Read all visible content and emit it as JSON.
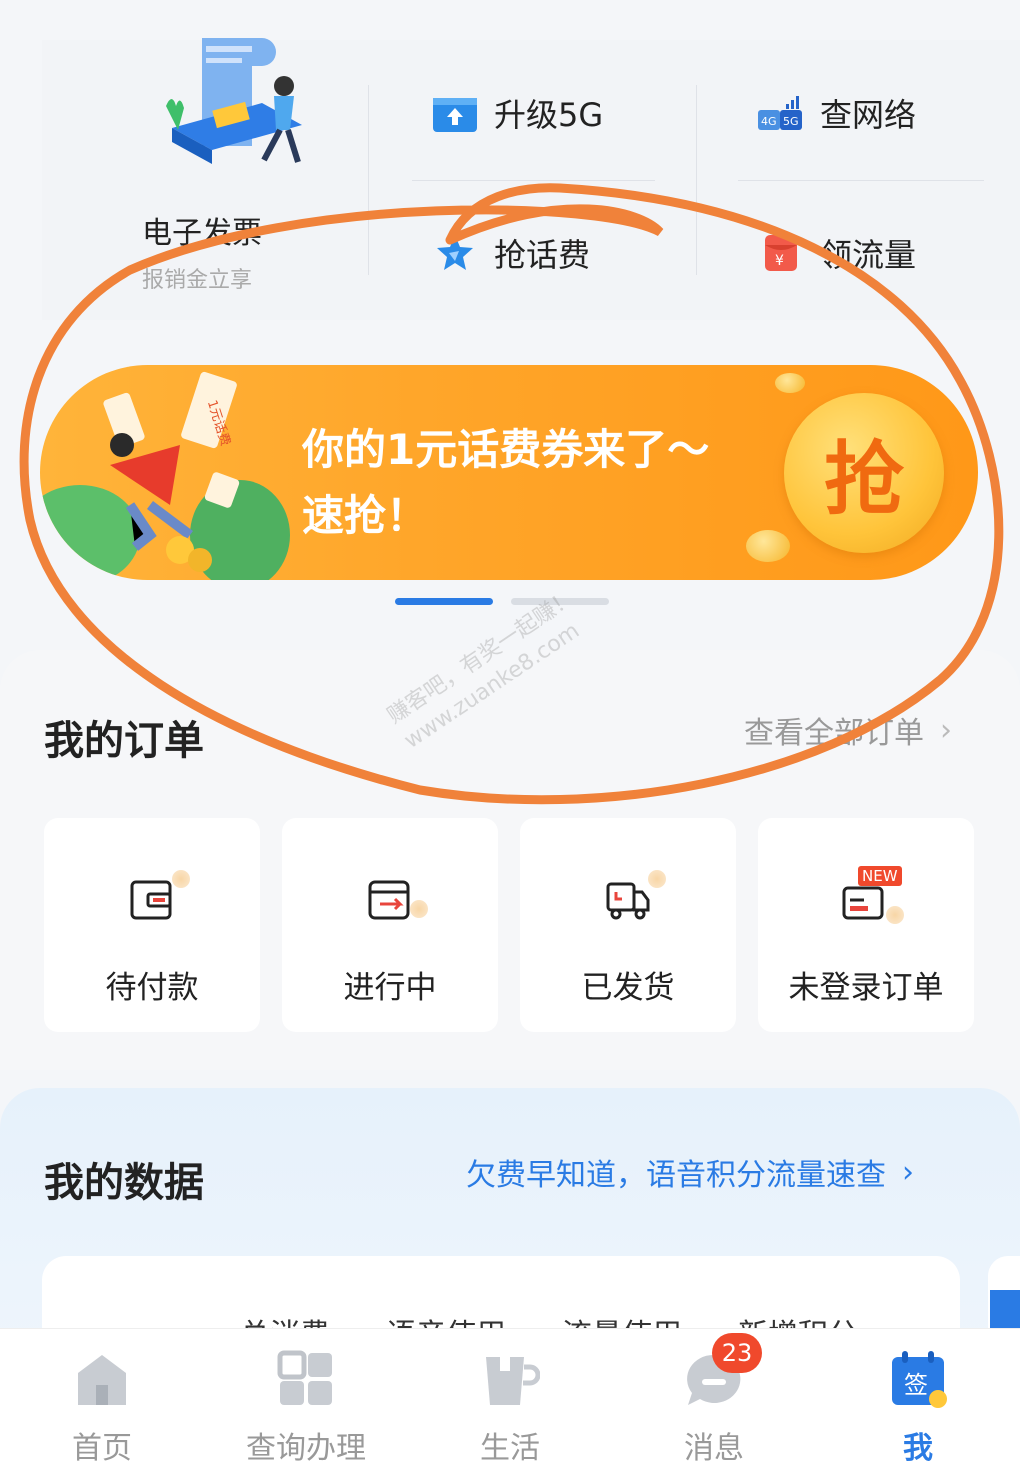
{
  "top": {
    "invoice_title": "电子发票",
    "invoice_sub": "报销金立享",
    "services": [
      {
        "label": "升级5G",
        "icon": "upload-icon"
      },
      {
        "label": "查网络",
        "icon": "4g5g-signal-icon"
      },
      {
        "label": "抢话费",
        "icon": "star-icon"
      },
      {
        "label": "领流量",
        "icon": "red-packet-icon"
      }
    ]
  },
  "banner": {
    "line1": "你的1元话费券来了～",
    "line2": "速抢！",
    "button": "抢",
    "ticket_text": "1元话费"
  },
  "orders": {
    "title": "我的订单",
    "link": "查看全部订单",
    "items": [
      {
        "label": "待付款",
        "icon": "wallet-icon"
      },
      {
        "label": "进行中",
        "icon": "in-progress-icon"
      },
      {
        "label": "已发货",
        "icon": "truck-icon"
      },
      {
        "label": "未登录订单",
        "icon": "card-icon",
        "badge": "NEW"
      }
    ]
  },
  "data": {
    "title": "我的数据",
    "link": "欠费早知道，语音积分流量速查",
    "labels": [
      "总消费",
      "语音使用",
      "流量使用",
      "新增积分"
    ]
  },
  "watermark": {
    "line1": "赚客吧，有奖一起赚！",
    "line2": "www.zuanke8.com"
  },
  "nav": {
    "items": [
      {
        "label": "首页",
        "icon": "home-icon"
      },
      {
        "label": "查询办理",
        "icon": "grid-icon"
      },
      {
        "label": "生活",
        "icon": "cup-icon"
      },
      {
        "label": "消息",
        "icon": "message-icon"
      },
      {
        "label": "我",
        "icon": "sign-in-calendar-icon",
        "sub": "签"
      }
    ],
    "message_badge": "23"
  },
  "colors": {
    "accent": "#2a7be4",
    "banner": "#ffa62a",
    "annotation": "#f0823a",
    "badge": "#f0492c"
  }
}
